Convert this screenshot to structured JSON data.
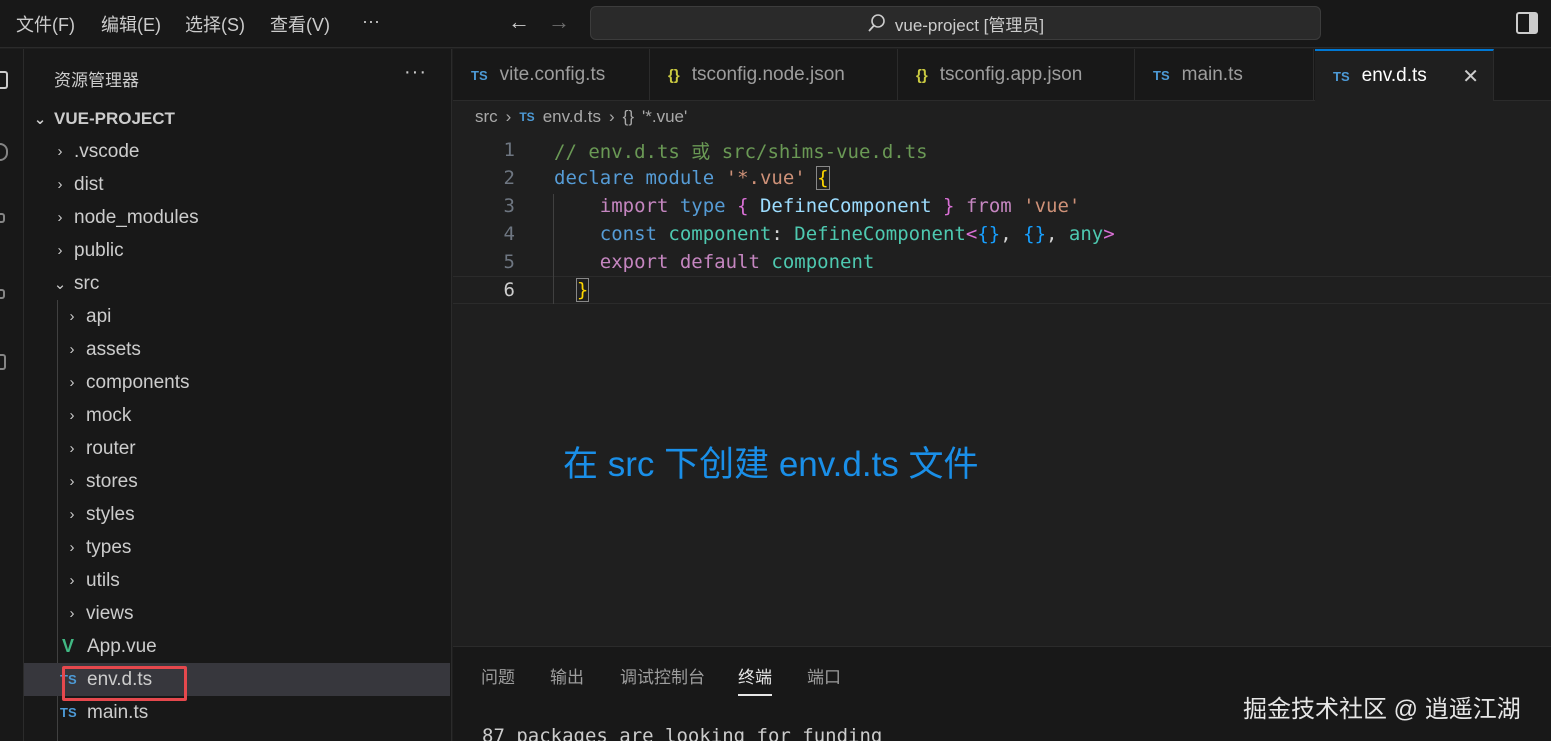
{
  "menu": {
    "file": "文件(F)",
    "edit": "编辑(E)",
    "selection": "选择(S)",
    "view": "查看(V)",
    "more": "···"
  },
  "command_center": {
    "text": "vue-project [管理员]"
  },
  "sidebar": {
    "title": "资源管理器",
    "more": "···",
    "project": "VUE-PROJECT",
    "tree": {
      "vscode": ".vscode",
      "dist": "dist",
      "node_modules": "node_modules",
      "public": "public",
      "src": "src",
      "api": "api",
      "assets": "assets",
      "components": "components",
      "mock": "mock",
      "router": "router",
      "stores": "stores",
      "styles": "styles",
      "types": "types",
      "utils": "utils",
      "views": "views",
      "app_vue": "App.vue",
      "env_d_ts": "env.d.ts",
      "main_ts": "main.ts"
    }
  },
  "tabs": {
    "vite_config": "vite.config.ts",
    "tsconfig_node": "tsconfig.node.json",
    "tsconfig_app": "tsconfig.app.json",
    "main_ts": "main.ts",
    "env_d_ts": "env.d.ts",
    "ts_badge": "TS",
    "json_badge": "{}",
    "close": "✕"
  },
  "breadcrumb": {
    "folder": "src",
    "file": "env.d.ts",
    "symbol_icon": "{}",
    "symbol": "'*.vue'"
  },
  "editor": {
    "line_numbers": [
      "1",
      "2",
      "3",
      "4",
      "5",
      "6"
    ],
    "active_line": 6,
    "line1": "// env.d.ts 或 src/shims-vue.d.ts",
    "line2": {
      "kw": "declare",
      "kw2": "module",
      "str": "'*.vue'",
      "brace": "{"
    },
    "line3": {
      "kw_import": "import",
      "kw_type": "type",
      "open": "{",
      "name": "DefineComponent",
      "close": "}",
      "kw_from": "from",
      "str": "'vue'"
    },
    "line4": {
      "kw_const": "const",
      "var": "component",
      "colon": ":",
      "type": "DefineComponent",
      "lt": "<",
      "obj1": "{}",
      "comma1": ",",
      "obj2": "{}",
      "comma2": ",",
      "any": "any",
      "gt": ">"
    },
    "line5": {
      "kw_export": "export",
      "kw_default": "default",
      "var": "component"
    },
    "line6": {
      "brace": "}"
    }
  },
  "annotation": "在 src 下创建 env.d.ts 文件",
  "panel": {
    "tabs": [
      "问题",
      "输出",
      "调试控制台",
      "终端",
      "端口"
    ],
    "active_tab": "终端",
    "terminal_text": "87 packages are looking for funding"
  },
  "watermark": "掘金技术社区 @ 逍遥江湖",
  "colors": {
    "accent": "#0078d4",
    "highlight_box": "#e5484d",
    "annotation": "#1a8fe8"
  },
  "icons": [
    "back-arrow-icon",
    "forward-arrow-icon",
    "search-icon",
    "layout-toggle-icon",
    "chevron-right-icon",
    "chevron-down-icon",
    "typescript-file-icon",
    "json-file-icon",
    "vue-file-icon",
    "close-icon"
  ]
}
